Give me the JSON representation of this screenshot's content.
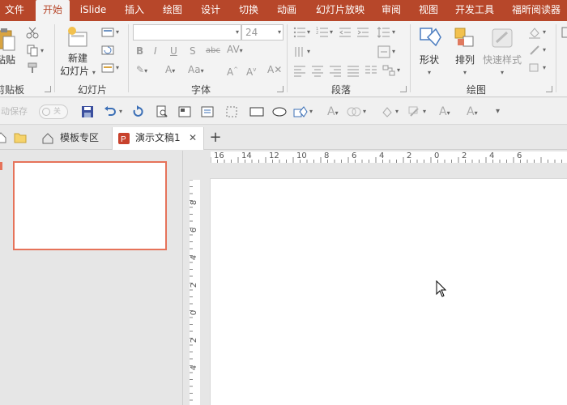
{
  "menubar": {
    "items": [
      {
        "label": "文件",
        "active": false
      },
      {
        "label": "开始",
        "active": true
      },
      {
        "label": "iSlide",
        "active": false
      },
      {
        "label": "插入",
        "active": false
      },
      {
        "label": "绘图",
        "active": false
      },
      {
        "label": "设计",
        "active": false
      },
      {
        "label": "切换",
        "active": false
      },
      {
        "label": "动画",
        "active": false
      },
      {
        "label": "幻灯片放映",
        "active": false
      },
      {
        "label": "审阅",
        "active": false
      },
      {
        "label": "视图",
        "active": false
      },
      {
        "label": "开发工具",
        "active": false
      },
      {
        "label": "福昕阅读器",
        "active": false
      }
    ],
    "accent_color": "#b7472a"
  },
  "ribbon": {
    "clipboard": {
      "paste_label": "粘贴",
      "group_label": "剪贴板"
    },
    "slides": {
      "new_slide_label_line1": "新建",
      "new_slide_label_line2": "幻灯片",
      "group_label": "幻灯片"
    },
    "font": {
      "font_name_value": "",
      "font_size_value": "24",
      "group_label": "字体"
    },
    "paragraph": {
      "group_label": "段落"
    },
    "drawing": {
      "shapes_label": "形状",
      "arrange_label": "排列",
      "quick_styles_label": "快速样式",
      "group_label": "绘图"
    }
  },
  "qat": {
    "autosave_label": "自动保存",
    "autosave_toggle": "关"
  },
  "doc_tabs": {
    "template_label": "模板专区",
    "doc_label": "演示文稿1",
    "close_glyph": "✕",
    "new_tab_glyph": "+"
  },
  "ruler": {
    "horizontal_labels": [
      "16",
      "14",
      "12",
      "10",
      "8",
      "6",
      "4",
      "2",
      "0",
      "2",
      "4",
      "6"
    ],
    "vertical_labels": [
      "8",
      "6",
      "4",
      "2",
      "0",
      "2",
      "4"
    ]
  },
  "slide_panel": {
    "selected_border_color": "#e6735a"
  }
}
